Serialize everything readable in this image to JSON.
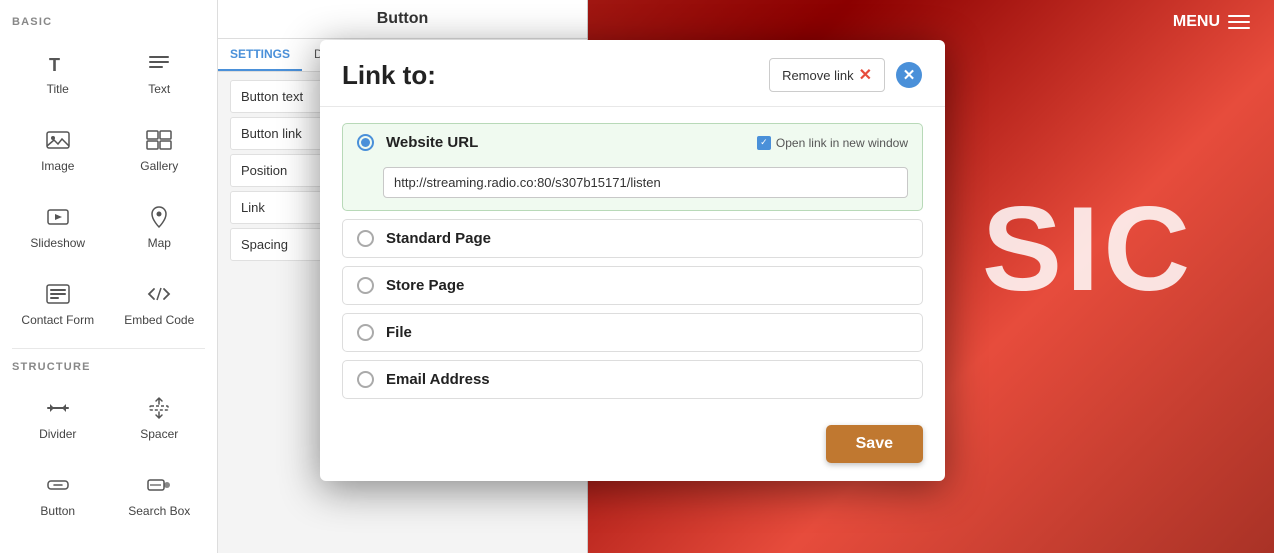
{
  "app": {
    "menu_label": "MENU"
  },
  "sidebar": {
    "section_basic": "BASIC",
    "section_structure": "STRUCTURE",
    "items": [
      {
        "id": "title",
        "label": "Title",
        "icon": "T"
      },
      {
        "id": "text",
        "label": "Text",
        "icon": "lines"
      },
      {
        "id": "image",
        "label": "Image",
        "icon": "image"
      },
      {
        "id": "gallery",
        "label": "Gallery",
        "icon": "gallery"
      },
      {
        "id": "slideshow",
        "label": "Slideshow",
        "icon": "slideshow"
      },
      {
        "id": "map",
        "label": "Map",
        "icon": "map"
      },
      {
        "id": "contact-form",
        "label": "Contact Form",
        "icon": "contact"
      },
      {
        "id": "embed-code",
        "label": "Embed Code",
        "icon": "embed"
      },
      {
        "id": "divider",
        "label": "Divider",
        "icon": "divider"
      },
      {
        "id": "spacer",
        "label": "Spacer",
        "icon": "spacer"
      },
      {
        "id": "button",
        "label": "Button",
        "icon": "button"
      },
      {
        "id": "search-box",
        "label": "Search Box",
        "icon": "search"
      }
    ]
  },
  "center_panel": {
    "header": "Button",
    "tabs": [
      "SETTINGS",
      "DESIGN"
    ],
    "rows": [
      "Button text",
      "Button link",
      "Position",
      "Link",
      "Spacing"
    ],
    "active_tab": "SETTINGS"
  },
  "modal": {
    "title": "Link to:",
    "remove_link_label": "Remove link",
    "close_aria": "Close",
    "options": [
      {
        "id": "website-url",
        "label": "Website URL",
        "selected": true,
        "has_new_window": true,
        "new_window_label": "Open link in new window",
        "url_value": "http://streaming.radio.co:80/s307b15171/listen"
      },
      {
        "id": "standard-page",
        "label": "Standard Page",
        "selected": false
      },
      {
        "id": "store-page",
        "label": "Store Page",
        "selected": false
      },
      {
        "id": "file",
        "label": "File",
        "selected": false
      },
      {
        "id": "email-address",
        "label": "Email Address",
        "selected": false
      }
    ],
    "save_label": "Save"
  },
  "hero": {
    "text": "SIC"
  }
}
